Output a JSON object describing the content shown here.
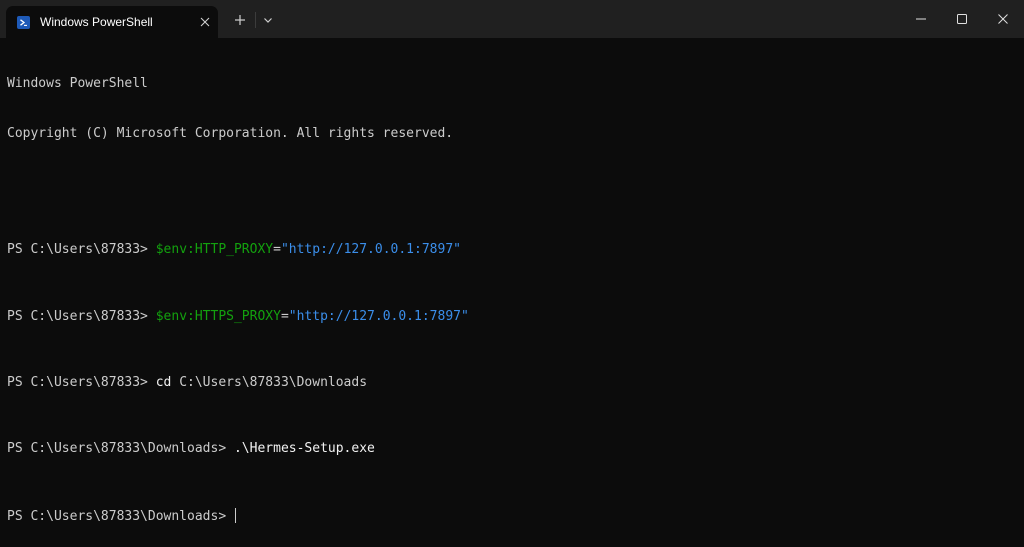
{
  "window": {
    "tab_title": "Windows PowerShell",
    "tab_icon": "powershell-icon",
    "new_tab_symbol": "+",
    "controls": [
      "minimize-icon",
      "maximize-icon",
      "close-icon"
    ]
  },
  "terminal": {
    "banner_line1": "Windows PowerShell",
    "banner_line2": "Copyright (C) Microsoft Corporation. All rights reserved.",
    "lines": [
      {
        "prompt": "PS C:\\Users\\87833> ",
        "var": "$env:HTTP_PROXY",
        "op": "=",
        "value": "\"http://127.0.0.1:7897\""
      },
      {
        "prompt": "PS C:\\Users\\87833> ",
        "var": "$env:HTTPS_PROXY",
        "op": "=",
        "value": "\"http://127.0.0.1:7897\""
      },
      {
        "prompt": "PS C:\\Users\\87833> ",
        "cmd": "cd",
        "arg": " C:\\Users\\87833\\Downloads"
      },
      {
        "prompt": "PS C:\\Users\\87833\\Downloads> ",
        "cmd": ".\\Hermes-Setup.exe"
      }
    ],
    "current_prompt": "PS C:\\Users\\87833\\Downloads> "
  },
  "colors": {
    "background": "#0c0c0c",
    "titlebar": "#202020",
    "text": "#cccccc",
    "variable": "#13a10e",
    "string": "#3b8eea"
  }
}
